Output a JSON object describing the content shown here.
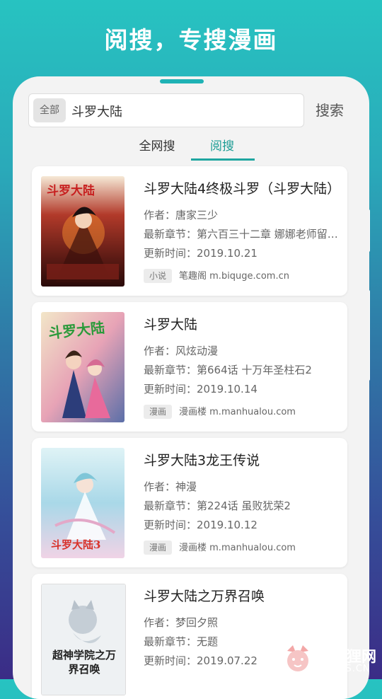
{
  "promo": {
    "title": "阅搜，专搜漫画"
  },
  "search": {
    "scope_label": "全部",
    "query": "斗罗大陆",
    "button_label": "搜索"
  },
  "tabs": [
    {
      "label": "全网搜",
      "selected": false
    },
    {
      "label": "阅搜",
      "selected": true
    }
  ],
  "labels": {
    "author": "作者：",
    "latest": "最新章节：",
    "updated": "更新时间："
  },
  "results": [
    {
      "title": "斗罗大陆4终极斗罗（斗罗大陆）",
      "author": "唐家三少",
      "latest_chapter": "第六百三十二章 娜娜老师留下的……",
      "update_time": "2019.10.21",
      "type_badge": "小说",
      "source": "笔趣阁 m.biquge.com.cn",
      "cover_text": "斗罗大陆"
    },
    {
      "title": "斗罗大陆",
      "author": "风炫动漫",
      "latest_chapter": "第664话 十万年圣柱石2",
      "update_time": "2019.10.14",
      "type_badge": "漫画",
      "source": "漫画楼 m.manhualou.com",
      "cover_text": "斗罗大陆"
    },
    {
      "title": "斗罗大陆3龙王传说",
      "author": "神漫",
      "latest_chapter": "第224话 虽败犹荣2",
      "update_time": "2019.10.12",
      "type_badge": "漫画",
      "source": "漫画楼 m.manhualou.com",
      "cover_text": "斗罗大陆3"
    },
    {
      "title": "斗罗大陆之万界召唤",
      "author": "梦回夕照",
      "latest_chapter": "无题",
      "update_time": "2019.07.22",
      "type_badge": "",
      "source": "",
      "cover_text": "超神学院之万界召唤"
    }
  ],
  "watermark": {
    "line1": "小狐狸网",
    "line2": "XHLKS.CN"
  },
  "colors": {
    "accent": "#1fa6a0",
    "bg_top": "#27c3c1",
    "bg_bottom": "#3b2c86"
  }
}
